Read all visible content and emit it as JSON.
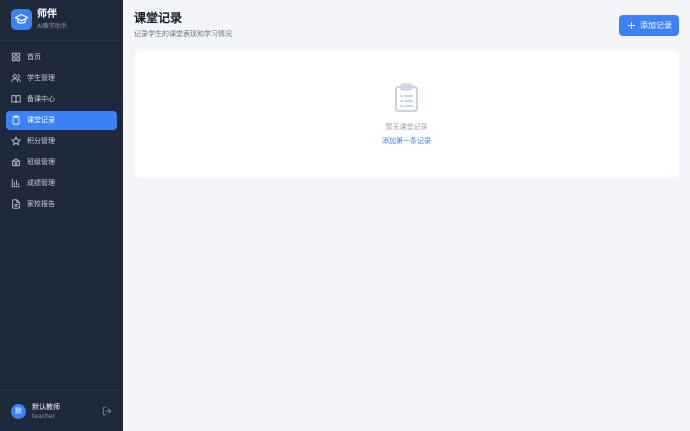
{
  "brand": {
    "name": "师伴",
    "subtitle": "AI教学助手"
  },
  "sidebar": {
    "items": [
      {
        "label": "首页",
        "icon": "grid-icon",
        "active": false
      },
      {
        "label": "学生管理",
        "icon": "users-icon",
        "active": false
      },
      {
        "label": "备课中心",
        "icon": "book-icon",
        "active": false
      },
      {
        "label": "课堂记录",
        "icon": "clipboard-icon",
        "active": true
      },
      {
        "label": "积分管理",
        "icon": "star-icon",
        "active": false
      },
      {
        "label": "班级管理",
        "icon": "school-icon",
        "active": false
      },
      {
        "label": "成绩管理",
        "icon": "bar-chart-icon",
        "active": false
      },
      {
        "label": "家校报告",
        "icon": "file-text-icon",
        "active": false
      }
    ]
  },
  "user": {
    "avatar": "默",
    "name": "默认教师",
    "role": "teacher"
  },
  "header": {
    "title": "课堂记录",
    "subtitle": "记录学生的课堂表现和学习情况",
    "add_label": "添加记录"
  },
  "empty": {
    "text": "暂无课堂记录",
    "link": "添加第一条记录"
  },
  "colors": {
    "accent": "#3b82f6",
    "sidebar_bg": "#1e293b",
    "page_bg": "#f3f5f9"
  }
}
